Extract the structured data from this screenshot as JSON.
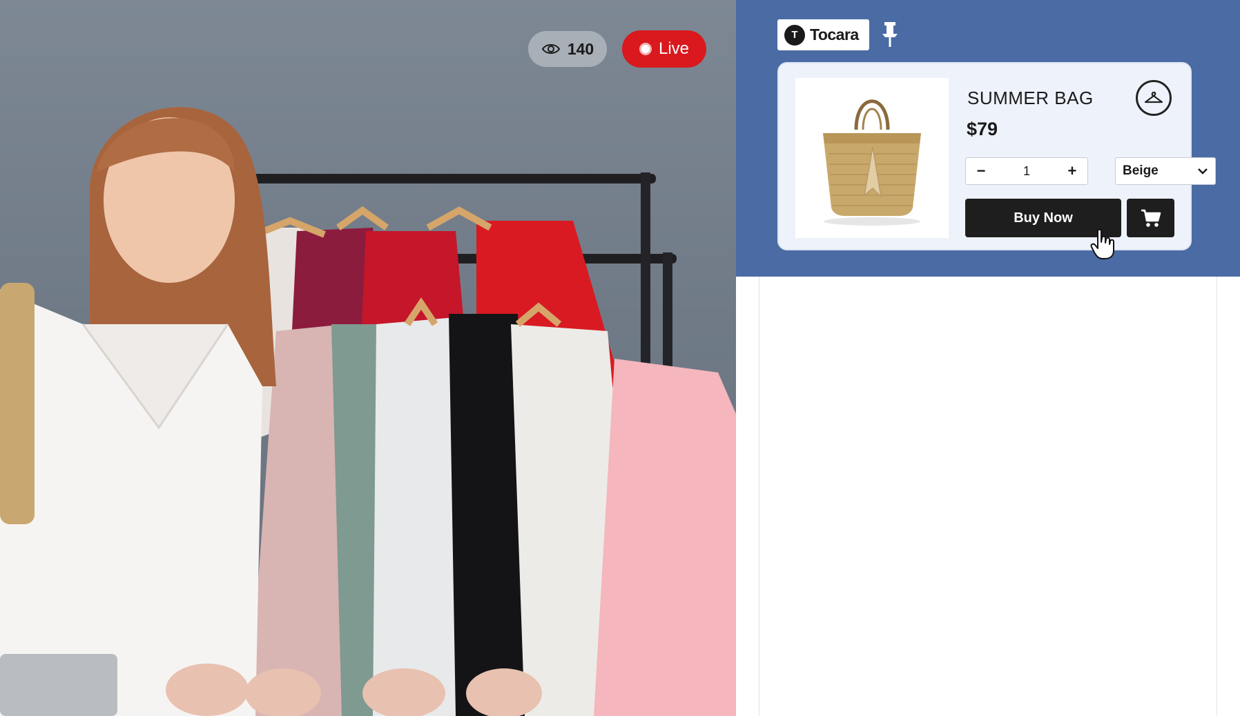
{
  "stream": {
    "viewer_count": "140",
    "live_label": "Live",
    "icons": {
      "viewers": "eye-icon",
      "live": "record-dot-icon"
    }
  },
  "brand": {
    "mark": "T",
    "name": "Tocara"
  },
  "product": {
    "title": "SUMMER BAG",
    "price": "$79",
    "quantity": "1",
    "decrement_label": "−",
    "increment_label": "+",
    "variant_selected": "Beige",
    "buy_label": "Buy Now",
    "icons": {
      "pin": "pin-icon",
      "hanger": "hanger-icon",
      "cart": "cart-icon",
      "dropdown": "chevron-down-icon"
    }
  },
  "colors": {
    "panel_bg": "#4a6ba4",
    "card_bg": "#eef2fb",
    "live_red": "#d9191d",
    "button_dark": "#1e1e1e"
  }
}
